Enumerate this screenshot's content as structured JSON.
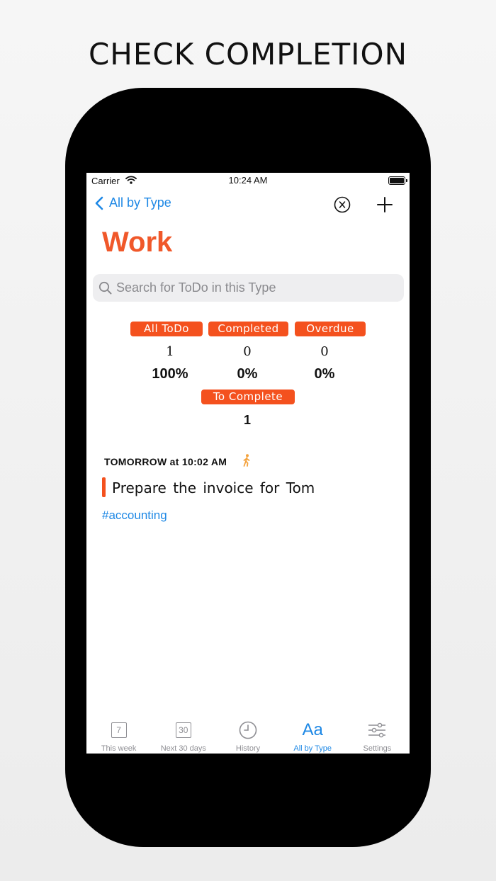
{
  "headline": "CHECK COMPLETION",
  "status_bar": {
    "carrier": "Carrier",
    "time": "10:24 AM"
  },
  "nav": {
    "back_label": "All by Type"
  },
  "page_title": "Work",
  "search": {
    "placeholder": "Search for ToDo in this Type",
    "value": ""
  },
  "stats": {
    "all_todo": {
      "label": "All ToDo",
      "count": "1",
      "percent": "100%"
    },
    "completed": {
      "label": "Completed",
      "count": "0",
      "percent": "0%"
    },
    "overdue": {
      "label": "Overdue",
      "count": "0",
      "percent": "0%"
    },
    "to_complete": {
      "label": "To Complete",
      "count": "1"
    }
  },
  "todo": {
    "due": "TOMORROW at 10:02 AM",
    "title": "Prepare the invoice for Tom",
    "tag": "#accounting"
  },
  "tabs": [
    {
      "label": "This week",
      "icon": "calendar-7-icon",
      "icon_text": "7"
    },
    {
      "label": "Next 30 days",
      "icon": "calendar-30-icon",
      "icon_text": "30"
    },
    {
      "label": "History",
      "icon": "clock-icon"
    },
    {
      "label": "All by Type",
      "icon": "text-aa-icon",
      "icon_text": "Aa",
      "active": true
    },
    {
      "label": "Settings",
      "icon": "sliders-icon"
    }
  ],
  "colors": {
    "accent": "#f4511e",
    "title": "#f0582a",
    "link": "#1e88e5",
    "inactive_tab": "#8e8e93"
  }
}
